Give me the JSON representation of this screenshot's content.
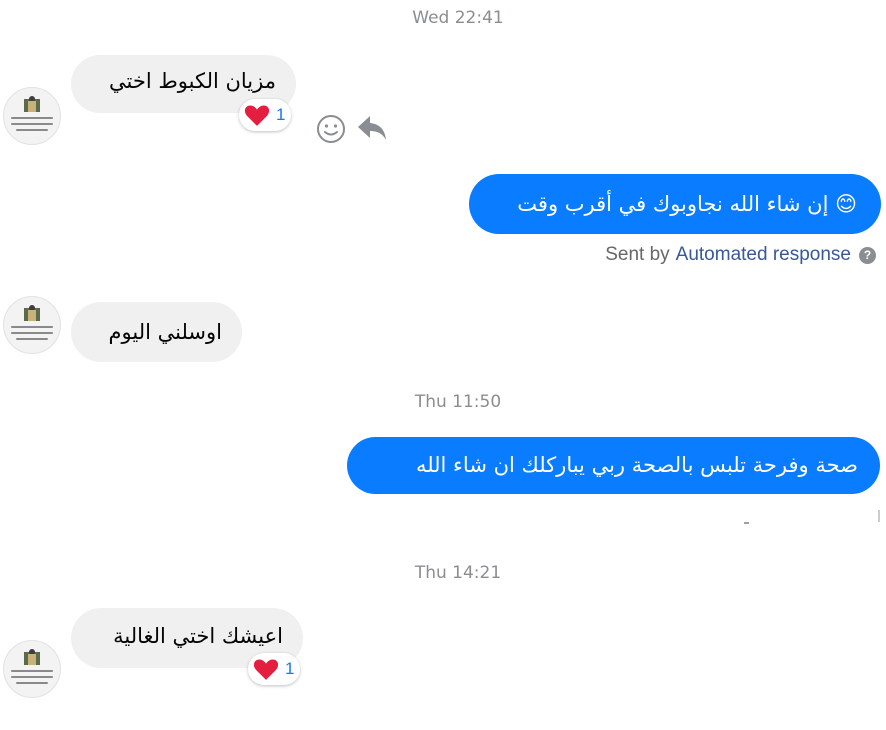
{
  "conversation": {
    "timestamps": [
      "Wed 22:41",
      "Thu 11:50",
      "Thu 14:21"
    ],
    "messages": [
      {
        "text": "مزيان الكبوط اختي",
        "reaction_count": "1"
      },
      {
        "text": "😊 إن شاء الله نجاوبوك في أقرب وقت"
      },
      {
        "text": "اوسلني اليوم"
      },
      {
        "text": "صحة  وفرحة تلبس بالصحة ربي يباركلك ان شاء الله"
      },
      {
        "text": "اعيشك اختي الغالية",
        "reaction_count": "1"
      }
    ],
    "sent_by": {
      "prefix": "Sent by",
      "link": "Automated response",
      "help": "?"
    }
  },
  "icons": {
    "reaction": "heart-icon",
    "emoji": "smiley-icon",
    "reply": "reply-arrow-icon",
    "help": "question-icon"
  },
  "colors": {
    "outgoing_bubble": "#0a7cff",
    "incoming_bubble": "#f0f0f0",
    "timestamp": "#8a8d91",
    "link": "#385898",
    "reaction_count": "#1877f2",
    "heart": "#e41e3f"
  }
}
